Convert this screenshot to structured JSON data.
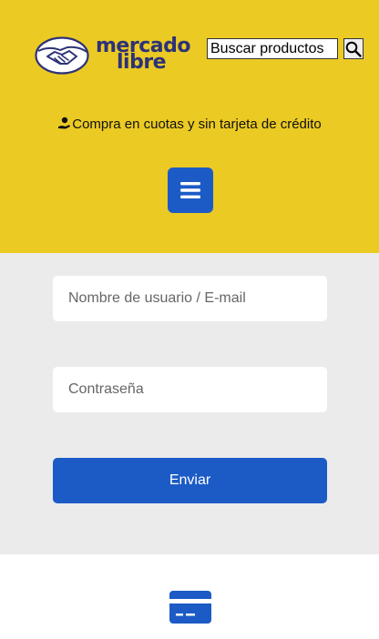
{
  "header": {
    "logo": {
      "line1": "mercado",
      "line2": "libre",
      "icon": "handshake-icon"
    },
    "search": {
      "placeholder": "Buscar productos",
      "button_icon": "search-icon"
    },
    "promo": {
      "icon": "hand-coin-icon",
      "text": "Compra en cuotas y sin tarjeta de crédito"
    },
    "menu_button_icon": "hamburger-menu-icon"
  },
  "login": {
    "username_placeholder": "Nombre de usuario / E-mail",
    "password_placeholder": "Contraseña",
    "submit_label": "Enviar"
  },
  "footer": {
    "icon": "credit-card-icon"
  },
  "colors": {
    "header_bg": "#ebca24",
    "form_bg": "#ebebeb",
    "accent_blue": "#1c5bc6",
    "logo_navy": "#2d3277"
  }
}
